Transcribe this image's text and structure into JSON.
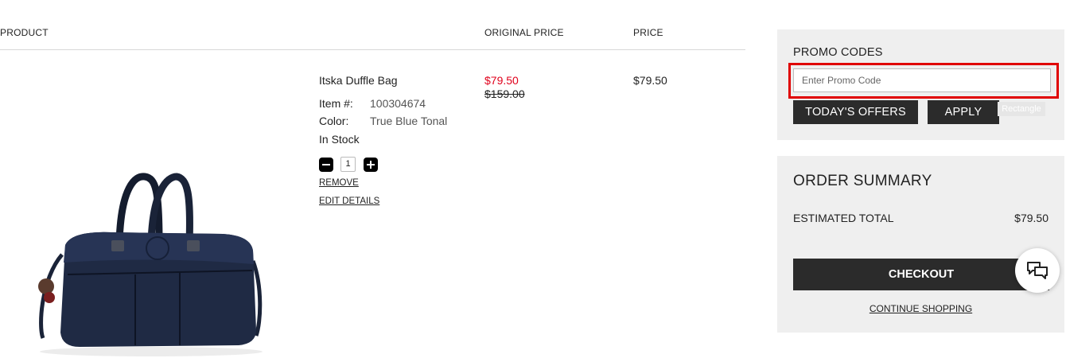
{
  "table": {
    "headers": {
      "product": "PRODUCT",
      "original_price": "ORIGINAL PRICE",
      "price": "PRICE"
    }
  },
  "item": {
    "name": "Itska Duffle Bag",
    "item_label": "Item #:",
    "item_number": "100304674",
    "color_label": "Color:",
    "color_value": "True Blue Tonal",
    "stock": "In Stock",
    "quantity": "1",
    "sale_price": "$79.50",
    "original_price": "$159.00",
    "price": "$79.50",
    "remove_label": "REMOVE",
    "edit_label": "EDIT DETAILS",
    "image_icon": "navy-duffle-bag-image"
  },
  "promo": {
    "title": "PROMO CODES",
    "placeholder": "Enter Promo Code",
    "offers_label": "TODAY'S OFFERS",
    "apply_label": "APPLY",
    "ghost_label": "Rectangle"
  },
  "summary": {
    "title": "ORDER SUMMARY",
    "estimated_label": "ESTIMATED TOTAL",
    "estimated_value": "$79.50",
    "checkout_label": "CHECKOUT",
    "continue_label": "CONTINUE SHOPPING"
  },
  "chat": {
    "icon": "chat-bubbles-icon"
  },
  "colors": {
    "sale_red": "#e0001b",
    "highlight_red": "#e00000",
    "button_dark": "#2b2b2b",
    "panel_bg": "#efefef"
  }
}
